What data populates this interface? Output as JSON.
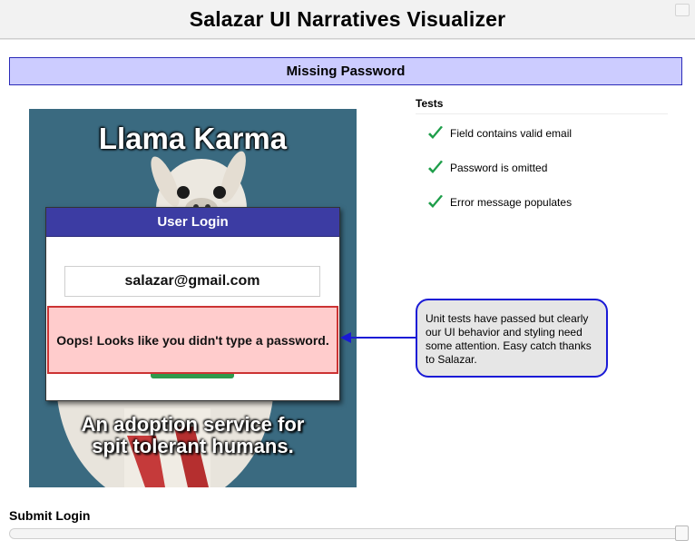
{
  "app": {
    "title": "Salazar UI Narratives Visualizer"
  },
  "scenario": {
    "name": "Missing Password"
  },
  "screenshot": {
    "brand": "Llama Karma",
    "tagline_line1": "An adoption service for",
    "tagline_line2": "spit tolerant humans.",
    "login": {
      "header": "User Login",
      "email_value": "salazar@gmail.com",
      "error_message": "Oops! Looks like you didn't type a password."
    }
  },
  "tests": {
    "title": "Tests",
    "items": [
      {
        "label": "Field contains valid email",
        "status": "passed",
        "icon": "checkmark-icon"
      },
      {
        "label": "Password is omitted",
        "status": "passed",
        "icon": "checkmark-icon"
      },
      {
        "label": "Error message populates",
        "status": "passed",
        "icon": "checkmark-icon"
      }
    ]
  },
  "annotation": {
    "text": "Unit tests have passed but clearly our UI behavior and styling need some attention. Easy catch thanks to Salazar."
  },
  "timeline": {
    "step_label": "Submit Login",
    "position_fraction": 1.0
  },
  "colors": {
    "scenario_bg": "#ccccff",
    "login_header": "#3c3ca3",
    "error_bg": "#ffcccc",
    "error_border": "#cc3333",
    "check_green": "#1e9e4a",
    "callout_border": "#1a1ad6"
  }
}
